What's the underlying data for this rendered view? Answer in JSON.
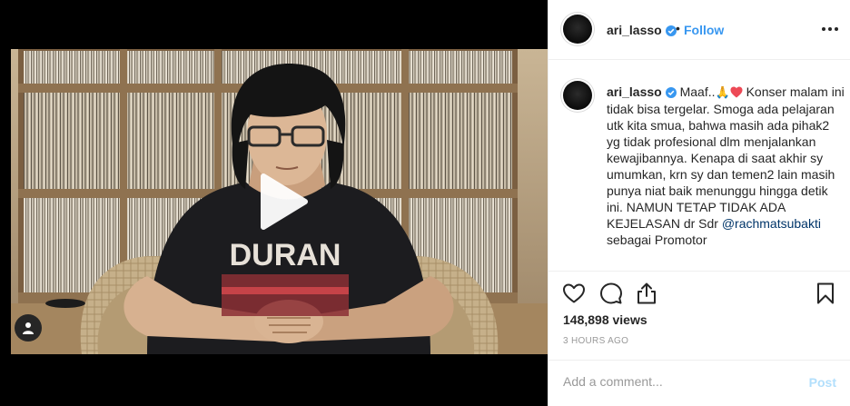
{
  "post": {
    "username": "ari_lasso",
    "follow_label": "Follow",
    "header_separator": "•",
    "caption": {
      "username": "ari_lasso",
      "text_part1": "Maaf..",
      "emoji_pray": "🙏",
      "text_part2": " Konser malam ini tidak bisa tergelar. Smoga ada pelajaran utk kita smua, bahwa masih ada pihak2 yg tidak profesional dlm menjalankan kewajibannya. Kenapa di saat akhir sy umumkan, krn sy dan temen2 lain masih punya niat baik menunggu hingga detik ini. NAMUN TETAP TIDAK ADA KEJELASAN dr Sdr ",
      "mention": "@rachmatsubakti",
      "text_part3": " sebagai Promotor"
    },
    "views": "148,898 views",
    "timestamp": "3 HOURS AGO",
    "comment_placeholder": "Add a comment...",
    "post_label": "Post"
  },
  "video": {
    "shirt_text": "DURAN"
  },
  "icons": {
    "verified": "verified-badge-icon",
    "more": "more-options-icon",
    "like": "heart-icon",
    "comment": "comment-icon",
    "share": "share-icon",
    "save": "bookmark-icon",
    "play": "play-icon",
    "user_tag": "user-tag-icon"
  },
  "colors": {
    "link_blue": "#3897f0",
    "mention_blue": "#003569",
    "post_disabled": "#b2dffc",
    "muted_text": "#999999",
    "verified_blue": "#3897f0",
    "heart_red": "#ed4956"
  }
}
